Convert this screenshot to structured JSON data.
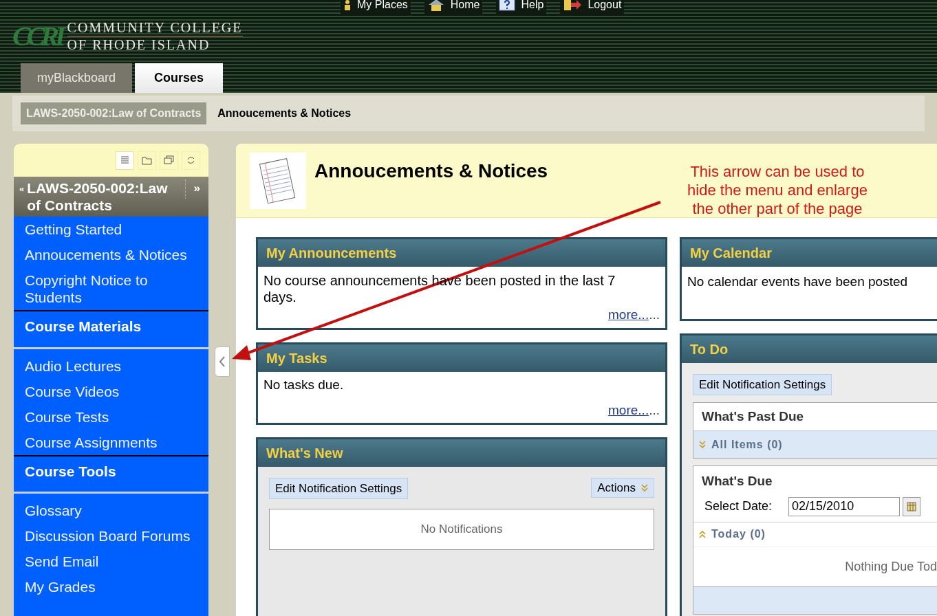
{
  "top_links": [
    {
      "label": "My Places",
      "kind": "places"
    },
    {
      "label": "Home",
      "kind": "home"
    },
    {
      "label": "Help",
      "kind": "help"
    },
    {
      "label": "Logout",
      "kind": "logout"
    }
  ],
  "logo": {
    "initials": "CCRI",
    "line1": "COMMUNITY COLLEGE",
    "line2": "OF RHODE ISLAND"
  },
  "tabs": [
    {
      "label": "myBlackboard",
      "selected": false
    },
    {
      "label": "Courses",
      "selected": true
    }
  ],
  "breadcrumb": {
    "course": "LAWS-2050-002:Law of Contracts",
    "page": "Annoucements & Notices"
  },
  "sidebar": {
    "title": "LAWS-2050-002:Law of Contracts",
    "collapse": "«",
    "expand": "»",
    "items": [
      {
        "kind": "link",
        "label": "Getting Started"
      },
      {
        "kind": "link",
        "label": "Annoucements & Notices"
      },
      {
        "kind": "link",
        "label": "Copyright Notice to Students"
      },
      {
        "kind": "heading",
        "label": "Course Materials"
      },
      {
        "kind": "link",
        "label": "Audio Lectures"
      },
      {
        "kind": "link",
        "label": "Course Videos"
      },
      {
        "kind": "link",
        "label": "Course Tests"
      },
      {
        "kind": "link",
        "label": "Course Assignments"
      },
      {
        "kind": "heading",
        "label": "Course Tools"
      },
      {
        "kind": "link",
        "label": "Glossary"
      },
      {
        "kind": "link",
        "label": "Discussion Board Forums"
      },
      {
        "kind": "link",
        "label": "Send Email"
      },
      {
        "kind": "link",
        "label": "My Grades"
      }
    ]
  },
  "page_title": "Annoucements & Notices",
  "annotation": "This arrow can be used to hide the menu and enlarge the other part of the page",
  "announcements": {
    "title": "My Announcements",
    "text": "No course announcements have been posted in the last 7 days.",
    "more": "more...",
    "dots": "..."
  },
  "tasks": {
    "title": "My Tasks",
    "text": "No tasks due.",
    "more": "more...",
    "dots": "..."
  },
  "whats_new": {
    "title": "What's New",
    "edit": "Edit Notification Settings",
    "actions": "Actions",
    "empty": "No Notifications"
  },
  "calendar": {
    "title": "My Calendar",
    "text": "No calendar events have been posted"
  },
  "todo": {
    "title": "To Do",
    "edit": "Edit Notification Settings",
    "past_due": {
      "title": "What's Past Due",
      "group": "All Items (0)",
      "expanded": false
    },
    "due": {
      "title": "What's Due",
      "date_label": "Select Date:",
      "date": "02/15/2010",
      "group": "Today (0)",
      "expanded": true,
      "empty": "Nothing Due Tod"
    }
  }
}
